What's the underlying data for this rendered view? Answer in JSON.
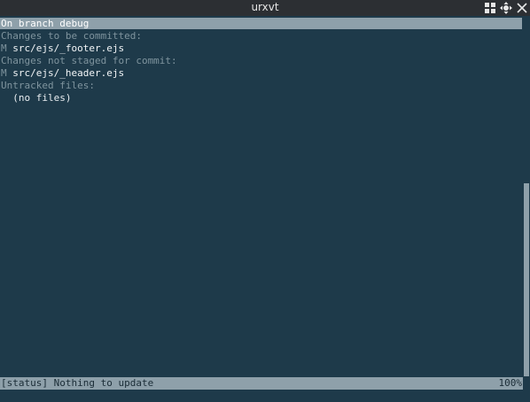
{
  "window": {
    "title": "urxvt",
    "buttons": [
      {
        "name": "tile-icon"
      },
      {
        "name": "move-icon"
      },
      {
        "name": "close-icon"
      }
    ]
  },
  "terminal": {
    "branch_line": "On branch debug",
    "staged_header": "Changes to be committed:",
    "staged_files": [
      {
        "flag": "M",
        "path": "src/ejs/_footer.ejs"
      }
    ],
    "unstaged_header": "Changes not staged for commit:",
    "unstaged_files": [
      {
        "flag": "M",
        "path": "src/ejs/_header.ejs"
      }
    ],
    "untracked_header": "Untracked files:",
    "untracked_placeholder": "  (no files)"
  },
  "status_bar": {
    "message": "[status] Nothing to update",
    "percent": "100%"
  },
  "colors": {
    "background": "#1e3a4a",
    "highlight": "#8ea0aa",
    "titlebar": "#2c2f33"
  }
}
